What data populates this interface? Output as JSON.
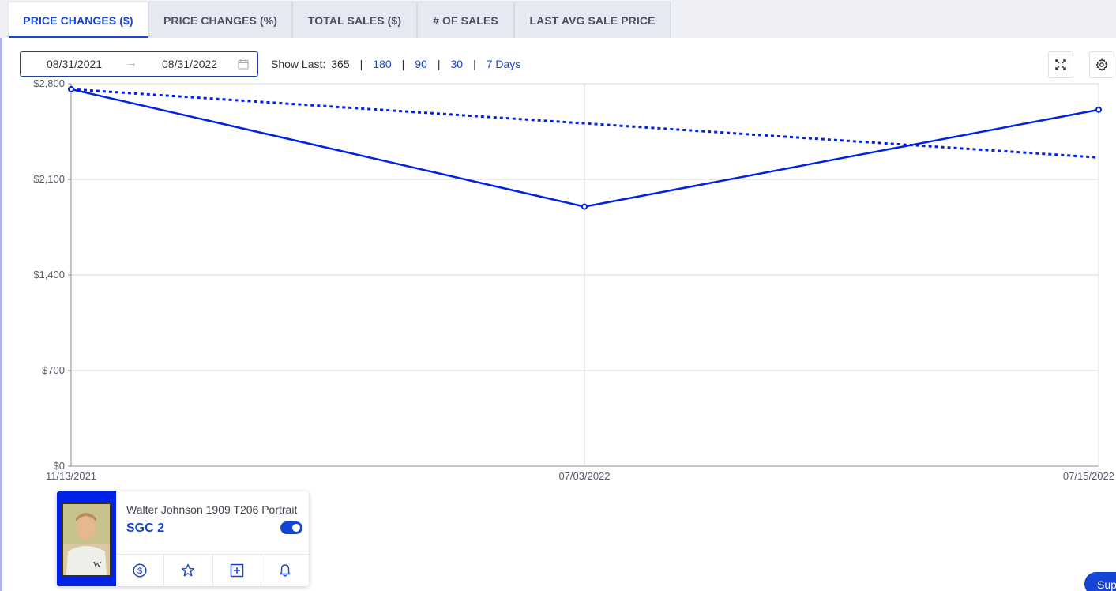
{
  "tabs": [
    {
      "label": "PRICE CHANGES ($)",
      "active": true
    },
    {
      "label": "PRICE CHANGES (%)",
      "active": false
    },
    {
      "label": "TOTAL SALES ($)",
      "active": false
    },
    {
      "label": "# OF SALES",
      "active": false
    },
    {
      "label": "LAST AVG SALE PRICE",
      "active": false
    }
  ],
  "date_range": {
    "start": "08/31/2021",
    "separator": "→",
    "end": "08/31/2022"
  },
  "show_last": {
    "label": "Show Last:",
    "current": "365",
    "separator": "|",
    "options": [
      "180",
      "90",
      "30",
      "7 Days"
    ]
  },
  "toolbar_icons": [
    "fullscreen-icon",
    "settings-icon"
  ],
  "colors": {
    "accent": "#1545d6",
    "line": "#0021e6",
    "grid": "#d9d9d9"
  },
  "chart_data": {
    "type": "line",
    "x": [
      "11/13/2021",
      "07/03/2022",
      "07/15/2022"
    ],
    "series": [
      {
        "style": "solid",
        "values": [
          2760,
          1900,
          2610
        ]
      },
      {
        "style": "dotted",
        "values": [
          2760,
          2510,
          2260
        ]
      }
    ],
    "y_ticks": [
      "$0",
      "$700",
      "$1,400",
      "$2,100",
      "$2,800"
    ],
    "ylim": [
      0,
      2800
    ],
    "grid": true,
    "markers": true
  },
  "card": {
    "title": "Walter Johnson 1909 T206 Portrait",
    "grade": "SGC 2",
    "toggle_on": true,
    "actions": [
      "dollar-icon",
      "star-icon",
      "add-box-icon",
      "bell-icon"
    ]
  },
  "support_label": "Sup"
}
